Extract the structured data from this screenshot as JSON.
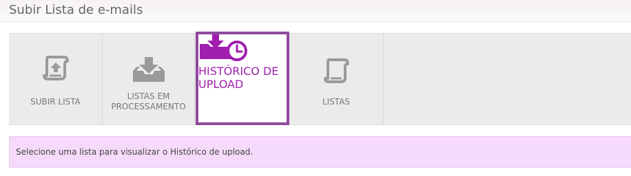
{
  "page": {
    "title": "Subir Lista de e-mails"
  },
  "tabs": [
    {
      "label": "SUBIR LISTA",
      "icon": "scroll-upload-icon",
      "active": false
    },
    {
      "label_line1": "LISTAS EM",
      "label_line2": "PROCESSAMENTO",
      "icon": "inbox-download-icon",
      "active": false
    },
    {
      "label_line1": "HISTÓRICO DE",
      "label_line2": "UPLOAD",
      "icon": "folder-download-clock-icon",
      "active": true
    },
    {
      "label": "LISTAS",
      "icon": "scroll-icon",
      "active": false
    }
  ],
  "message": {
    "text": "Selecione uma lista para visualizar o Histórico de upload."
  },
  "colors": {
    "accent": "#a01fb0",
    "active_border": "#8e4a9c",
    "tab_background": "#ebebeb",
    "icon_gray": "#9a9a9a",
    "message_background": "#f5dafb"
  }
}
